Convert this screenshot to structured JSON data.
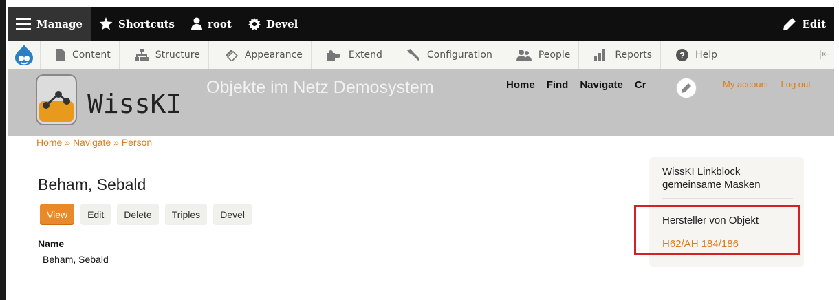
{
  "toolbar": {
    "manage": "Manage",
    "shortcuts": "Shortcuts",
    "user": "root",
    "devel": "Devel",
    "edit": "Edit"
  },
  "tray": {
    "items": [
      "Content",
      "Structure",
      "Appearance",
      "Extend",
      "Configuration",
      "People",
      "Reports",
      "Help"
    ]
  },
  "header": {
    "site_name": "WissKI",
    "slogan": "Objekte im Netz Demosystem",
    "main_menu": [
      "Home",
      "Find",
      "Navigate",
      "Cr"
    ],
    "secondary_menu": [
      "My account",
      "Log out"
    ]
  },
  "breadcrumb": {
    "items": [
      "Home",
      "Navigate",
      "Person"
    ],
    "separator": "»"
  },
  "page": {
    "title": "Beham, Sebald",
    "tabs": [
      "View",
      "Edit",
      "Delete",
      "Triples",
      "Devel"
    ],
    "field_label": "Name",
    "field_value": "Beham, Sebald"
  },
  "sidebar": {
    "block_title": "WissKI Linkblock gemeinsame Masken",
    "subtitle": "Hersteller von Objekt",
    "link": "H62/AH 184/186"
  },
  "colors": {
    "accent": "#e07b1a",
    "toolbar": "#0f0f0f",
    "header": "#c3c3c3",
    "highlight": "#d62027"
  }
}
